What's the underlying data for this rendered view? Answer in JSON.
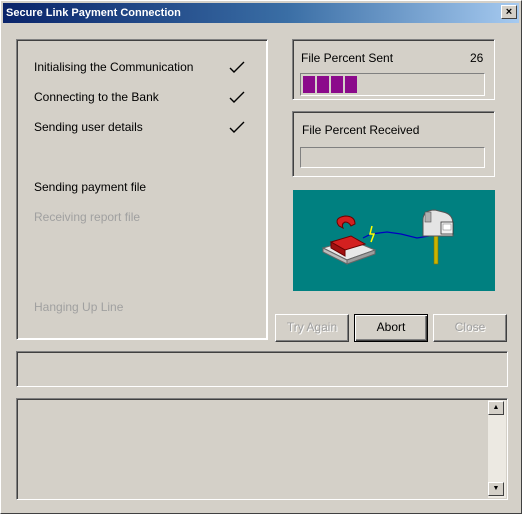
{
  "window": {
    "title": "Secure Link Payment Connection",
    "close_glyph": "×"
  },
  "steps": [
    {
      "label": "Initialising the Communication",
      "done": true
    },
    {
      "label": "Connecting to the Bank",
      "done": true
    },
    {
      "label": "Sending user details",
      "done": true
    },
    {
      "label": "Sending payment file",
      "done": false,
      "active": true
    },
    {
      "label": "Receiving report file",
      "done": false,
      "active": false
    },
    {
      "label": "Hanging Up Line",
      "done": false,
      "active": false
    }
  ],
  "sent": {
    "label": "File Percent Sent",
    "value": "26",
    "progress_percent": 26
  },
  "received": {
    "label": "File Percent Received",
    "progress_percent": 0
  },
  "illustration": {
    "icon": "phone-to-mailbox-icon",
    "background": "#008080"
  },
  "buttons": {
    "try_again": "Try Again",
    "abort": "Abort",
    "close": "Close"
  },
  "status_text": "",
  "log_text": "",
  "colors": {
    "progress": "#8b0a8b",
    "title_start": "#0a246a",
    "title_end": "#a6caf0"
  }
}
